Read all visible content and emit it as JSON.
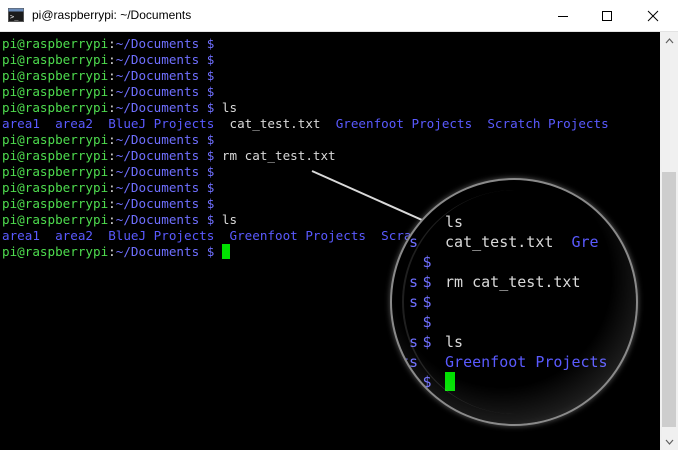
{
  "window": {
    "title": "pi@raspberrypi: ~/Documents",
    "minimize": "—",
    "maximize": "☐",
    "close": "✕"
  },
  "prompt": {
    "user": "pi@raspberrypi",
    "sep": ":",
    "path": "~/Documents",
    "dollar": " $"
  },
  "terminal_lines": [
    {
      "type": "prompt",
      "cmd": ""
    },
    {
      "type": "prompt",
      "cmd": ""
    },
    {
      "type": "prompt",
      "cmd": ""
    },
    {
      "type": "prompt",
      "cmd": ""
    },
    {
      "type": "prompt",
      "cmd": " ls"
    },
    {
      "type": "output",
      "items": [
        {
          "text": "area1",
          "kind": "dir"
        },
        {
          "text": "  ",
          "kind": "space"
        },
        {
          "text": "area2",
          "kind": "dir"
        },
        {
          "text": "  ",
          "kind": "space"
        },
        {
          "text": "BlueJ Projects",
          "kind": "dir"
        },
        {
          "text": "  ",
          "kind": "space"
        },
        {
          "text": "cat_test.txt",
          "kind": "file"
        },
        {
          "text": "  ",
          "kind": "space"
        },
        {
          "text": "Greenfoot Projects",
          "kind": "dir"
        },
        {
          "text": "  ",
          "kind": "space"
        },
        {
          "text": "Scratch Projects",
          "kind": "dir"
        }
      ]
    },
    {
      "type": "prompt",
      "cmd": ""
    },
    {
      "type": "prompt",
      "cmd": " rm cat_test.txt"
    },
    {
      "type": "prompt",
      "cmd": ""
    },
    {
      "type": "prompt",
      "cmd": ""
    },
    {
      "type": "prompt",
      "cmd": ""
    },
    {
      "type": "prompt",
      "cmd": " ls"
    },
    {
      "type": "output",
      "items": [
        {
          "text": "area1",
          "kind": "dir"
        },
        {
          "text": "  ",
          "kind": "space"
        },
        {
          "text": "area2",
          "kind": "dir"
        },
        {
          "text": "  ",
          "kind": "space"
        },
        {
          "text": "BlueJ Projects",
          "kind": "dir"
        },
        {
          "text": "  ",
          "kind": "space"
        },
        {
          "text": "Greenfoot Projects",
          "kind": "dir"
        },
        {
          "text": "  ",
          "kind": "space"
        },
        {
          "text": "Scratch Projects",
          "kind": "dir"
        }
      ]
    },
    {
      "type": "prompt",
      "cmd": "",
      "cursor": true
    }
  ],
  "magnifier": {
    "lines": [
      {
        "pre": "",
        "dollar": "",
        "text": "ls"
      },
      {
        "pre": "s",
        "dollar": "",
        "text": "cat_test.txt  Gre"
      },
      {
        "pre": "",
        "dollar": "$",
        "text": ""
      },
      {
        "pre": "s",
        "dollar": "$",
        "text": "rm cat_test.txt"
      },
      {
        "pre": "s",
        "dollar": "$",
        "text": ""
      },
      {
        "pre": "",
        "dollar": "$",
        "text": ""
      },
      {
        "pre": "s",
        "dollar": "$",
        "text": "ls"
      },
      {
        "pre": "ts",
        "dollar": "",
        "text": "Greenfoot Projects"
      },
      {
        "pre": "s",
        "dollar": "$",
        "text": "",
        "cursor": true
      }
    ]
  },
  "colors": {
    "user": "#4edc4e",
    "path": "#6f6fff",
    "directory": "#5a5aff",
    "text": "#d9d9d9",
    "cursor": "#00e000",
    "background": "#000000"
  }
}
